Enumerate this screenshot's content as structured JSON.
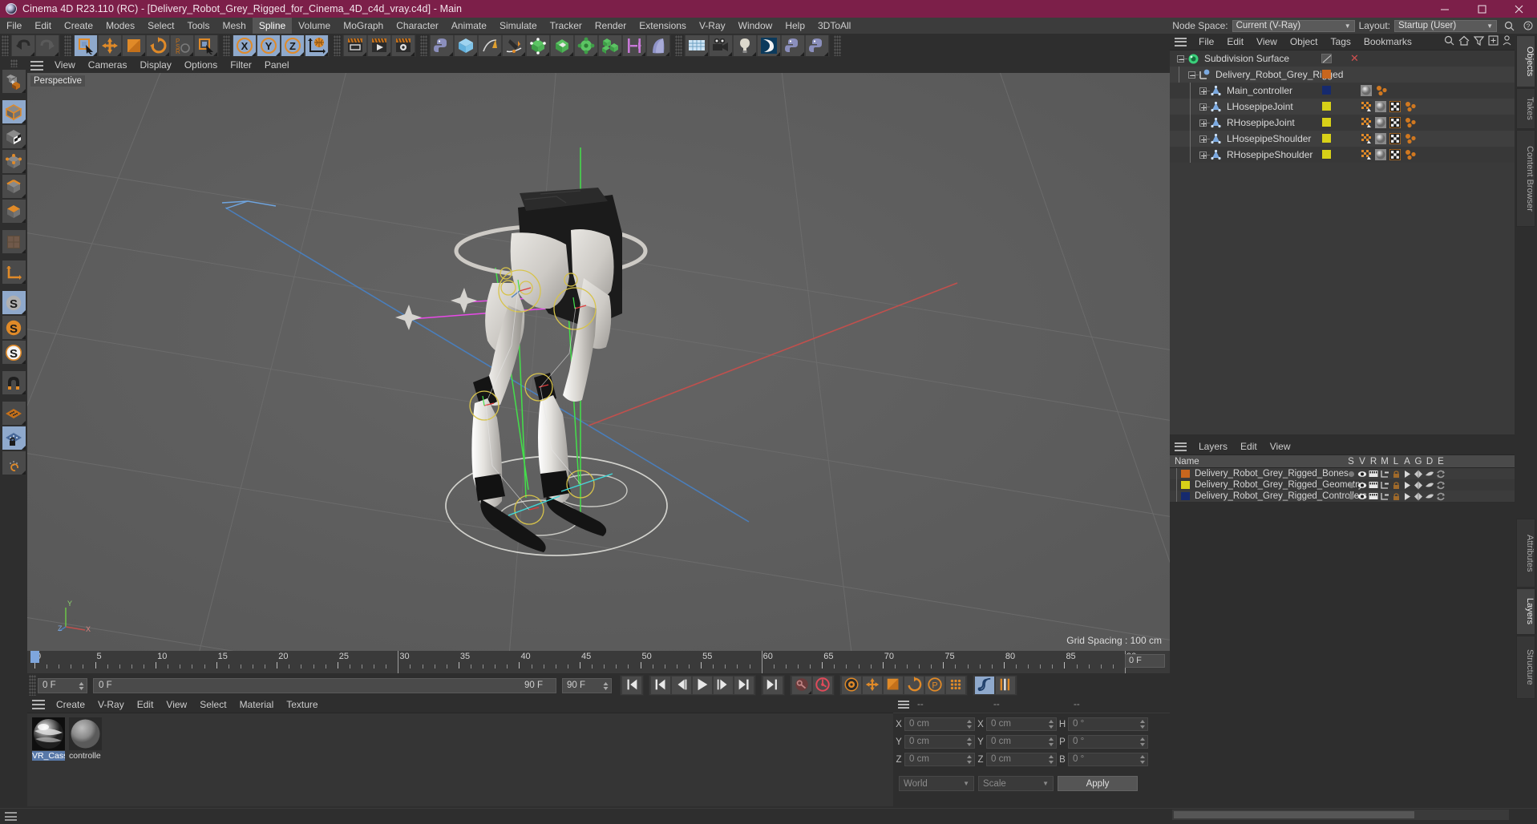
{
  "window": {
    "title": "Cinema 4D R23.110 (RC) - [Delivery_Robot_Grey_Rigged_for_Cinema_4D_c4d_vray.c4d] - Main",
    "minimize": "─",
    "maximize": "□",
    "close": "✕",
    "titlebar_color": "#7c1f49"
  },
  "menubar": {
    "items": [
      {
        "label": "File"
      },
      {
        "label": "Edit"
      },
      {
        "label": "Create"
      },
      {
        "label": "Modes"
      },
      {
        "label": "Select"
      },
      {
        "label": "Tools"
      },
      {
        "label": "Mesh"
      },
      {
        "label": "Spline",
        "active": true
      },
      {
        "label": "Volume"
      },
      {
        "label": "MoGraph"
      },
      {
        "label": "Character"
      },
      {
        "label": "Animate"
      },
      {
        "label": "Simulate"
      },
      {
        "label": "Tracker"
      },
      {
        "label": "Render"
      },
      {
        "label": "Extensions"
      },
      {
        "label": "V-Ray"
      },
      {
        "label": "Window"
      },
      {
        "label": "Help"
      },
      {
        "label": "3DToAll"
      }
    ],
    "node_space_label": "Node Space:",
    "node_space_value": "Current (V-Ray)",
    "layout_label": "Layout:",
    "layout_value": "Startup (User)"
  },
  "toolbar": {
    "groups": [
      {
        "name": "history",
        "buttons": [
          {
            "name": "undo-button",
            "icon": "undo"
          },
          {
            "name": "redo-button",
            "icon": "redo"
          }
        ]
      },
      {
        "name": "transform",
        "buttons": [
          {
            "name": "select-tool-button",
            "icon": "select-cursor",
            "selected": true
          },
          {
            "name": "move-tool-button",
            "icon": "move-arrows"
          },
          {
            "name": "scale-tool-button",
            "icon": "scale-box"
          },
          {
            "name": "rotate-tool-button",
            "icon": "rotate-arrows"
          },
          {
            "name": "psr-lock-button",
            "icon": "psr"
          },
          {
            "name": "live-selection-button",
            "icon": "select-cursor"
          }
        ]
      },
      {
        "name": "axis-locks",
        "buttons": [
          {
            "name": "lock-x-axis-button",
            "icon": "axis-x",
            "selected": true
          },
          {
            "name": "lock-y-axis-button",
            "icon": "axis-y",
            "selected": true
          },
          {
            "name": "lock-z-axis-button",
            "icon": "axis-z",
            "selected": true
          },
          {
            "name": "world-coordinates-button",
            "icon": "globe-axis",
            "selected": true
          }
        ]
      },
      {
        "name": "render",
        "buttons": [
          {
            "name": "render-view-button",
            "icon": "render-view"
          },
          {
            "name": "render-to-picture-viewer-button",
            "icon": "render-picture"
          },
          {
            "name": "render-settings-button",
            "icon": "render-settings"
          }
        ]
      },
      {
        "name": "objects",
        "buttons": [
          {
            "name": "python-generator-button",
            "icon": "python"
          },
          {
            "name": "add-cube-button",
            "icon": "cube-blue"
          },
          {
            "name": "add-spline-button",
            "icon": "spline-pen"
          },
          {
            "name": "spline-pen-button",
            "icon": "pen-curve"
          },
          {
            "name": "add-nurbs-button",
            "icon": "nurbs"
          },
          {
            "name": "add-array-button",
            "icon": "array-green"
          },
          {
            "name": "add-deformer-button",
            "icon": "deformer"
          },
          {
            "name": "add-modeling-object-button",
            "icon": "cubes-green"
          },
          {
            "name": "add-instance-button",
            "icon": "instance"
          },
          {
            "name": "add-bend-button",
            "icon": "bend"
          }
        ]
      },
      {
        "name": "scene",
        "buttons": [
          {
            "name": "add-floor-button",
            "icon": "floor-grid"
          },
          {
            "name": "add-camera-button",
            "icon": "camera"
          },
          {
            "name": "add-light-button",
            "icon": "light-bulb"
          },
          {
            "name": "vray-bridge-button",
            "icon": "vray-logo"
          },
          {
            "name": "python-script-button",
            "icon": "python"
          },
          {
            "name": "python-script-2-button",
            "icon": "python"
          }
        ]
      }
    ]
  },
  "left_toolbar": {
    "buttons": [
      {
        "name": "make-editable-button",
        "icon": "make-editable"
      },
      {
        "name": "model-mode-button",
        "icon": "model-cube",
        "selected": true
      },
      {
        "name": "texture-mode-button",
        "icon": "texture-cube"
      },
      {
        "name": "points-mode-button",
        "icon": "points-cube"
      },
      {
        "name": "edges-mode-button",
        "icon": "edges-cube"
      },
      {
        "name": "polygons-mode-button",
        "icon": "polygons-cube"
      },
      {
        "name": "uv-mode-button",
        "icon": "uv-grid"
      },
      {
        "name": "axis-mode-button",
        "icon": "axis-L"
      },
      {
        "name": "enable-snapping-button",
        "icon": "snap-s",
        "selected": true
      },
      {
        "name": "snap-settings-button",
        "icon": "snap-s-orange"
      },
      {
        "name": "quantize-button",
        "icon": "snap-s-white"
      },
      {
        "name": "magnet-button",
        "icon": "magnet"
      },
      {
        "name": "workplane-button",
        "icon": "workplane"
      },
      {
        "name": "lock-workplane-button",
        "icon": "workplane-lock",
        "selected": true
      },
      {
        "name": "planar-workplane-button",
        "icon": "workplane-rotate"
      }
    ]
  },
  "viewport": {
    "menu": [
      "View",
      "Cameras",
      "Display",
      "Options",
      "Filter",
      "Panel"
    ],
    "label": "Perspective",
    "grid_spacing": "Grid Spacing : 100 cm",
    "axis_labels": {
      "x": "X",
      "y": "Y",
      "z": "Z"
    },
    "background_color": "#5e5e5e",
    "axis_x_color": "#c0504d",
    "axis_z_color": "#4a7ebb",
    "axis_y_color": "#6bbf4a"
  },
  "object_manager": {
    "menu": [
      "File",
      "Edit",
      "View",
      "Object",
      "Tags",
      "Bookmarks"
    ],
    "icons": [
      "search-icon",
      "home-icon",
      "filter-icon",
      "plus-box-icon",
      "person-icon"
    ],
    "rows": [
      {
        "name": "Subdivision Surface",
        "depth": 0,
        "icon": "subdivision-surface",
        "swatch": null,
        "expander": "minus",
        "has_close": true,
        "tags": []
      },
      {
        "name": "Delivery_Robot_Grey_Rigged",
        "depth": 1,
        "icon": "null-object",
        "swatch": "#c8661e",
        "expander": "minus",
        "has_close": false,
        "tags": []
      },
      {
        "name": "Main_controller",
        "depth": 2,
        "icon": "joint",
        "swatch": "#162a6e",
        "expander": "plus",
        "has_close": false,
        "tags": [
          "sphere-tag",
          "dots-tag"
        ]
      },
      {
        "name": "LHosepipeJoint",
        "depth": 2,
        "icon": "joint",
        "swatch": "#d8d118",
        "expander": "plus",
        "has_close": false,
        "tags": [
          "weight-tag",
          "sphere-tag",
          "checker-tag",
          "dots-tag"
        ]
      },
      {
        "name": "RHosepipeJoint",
        "depth": 2,
        "icon": "joint",
        "swatch": "#d8d118",
        "expander": "plus",
        "has_close": false,
        "tags": [
          "weight-tag",
          "sphere-tag",
          "checker-tag",
          "dots-tag"
        ]
      },
      {
        "name": "LHosepipeShoulder",
        "depth": 2,
        "icon": "joint",
        "swatch": "#d8d118",
        "expander": "plus",
        "has_close": false,
        "tags": [
          "weight-tag",
          "sphere-tag",
          "checker-tag",
          "dots-tag"
        ]
      },
      {
        "name": "RHosepipeShoulder",
        "depth": 2,
        "icon": "joint",
        "swatch": "#d8d118",
        "expander": "plus",
        "has_close": false,
        "tags": [
          "weight-tag",
          "sphere-tag",
          "checker-tag",
          "dots-tag"
        ]
      }
    ]
  },
  "layers_manager": {
    "menu": [
      "Layers",
      "Edit",
      "View"
    ],
    "columns": [
      "Name",
      "S",
      "V",
      "R",
      "M",
      "L",
      "A",
      "G",
      "D",
      "E"
    ],
    "rows": [
      {
        "name": "Delivery_Robot_Grey_Rigged_Bones",
        "color": "#c8661e"
      },
      {
        "name": "Delivery_Robot_Grey_Rigged_Geometry",
        "color": "#d8d118"
      },
      {
        "name": "Delivery_Robot_Grey_Rigged_Controllers",
        "color": "#162a6e"
      }
    ]
  },
  "right_tabs": {
    "top": [
      {
        "label": "Objects",
        "active": true
      },
      {
        "label": "Takes",
        "active": false
      },
      {
        "label": "Content Browser",
        "active": false
      }
    ],
    "bottom": [
      {
        "label": "Attributes",
        "active": false
      },
      {
        "label": "Layers",
        "active": true
      },
      {
        "label": "Structure",
        "active": false
      }
    ]
  },
  "timeline": {
    "ticks": [
      0,
      5,
      10,
      15,
      20,
      25,
      30,
      35,
      40,
      45,
      50,
      55,
      60,
      65,
      70,
      75,
      80,
      85,
      90
    ],
    "min_frame": 0,
    "max_frame": 90,
    "current_frame": 0,
    "current_frame_field": "0 F",
    "current_frame_spinner": "0 F",
    "range_start": "0 F",
    "range_end": "90 F",
    "preview_end": "90 F",
    "transport": [
      {
        "name": "go-to-start-button",
        "icon": "skip-start"
      },
      {
        "name": "previous-key-button",
        "icon": "prev-key"
      },
      {
        "name": "previous-frame-button",
        "icon": "prev-frame"
      },
      {
        "name": "play-button",
        "icon": "play"
      },
      {
        "name": "next-frame-button",
        "icon": "next-frame"
      },
      {
        "name": "next-key-button",
        "icon": "next-key"
      },
      {
        "name": "go-to-end-button",
        "icon": "skip-end"
      },
      {
        "name": "record-active-objects-button",
        "icon": "key-record"
      },
      {
        "name": "autokeying-button",
        "icon": "auto-key"
      },
      {
        "name": "keyframe-selection-button",
        "icon": "keyframe-gear"
      },
      {
        "name": "position-key-button",
        "icon": "position-cross"
      },
      {
        "name": "scale-key-button",
        "icon": "scale-key"
      },
      {
        "name": "rotation-key-button",
        "icon": "rotation-key"
      },
      {
        "name": "param-key-button",
        "icon": "param-p"
      },
      {
        "name": "point-level-animation-button",
        "icon": "pla-dots"
      },
      {
        "name": "animation-mode-button",
        "icon": "anim-mode",
        "selected": true
      },
      {
        "name": "timeline-toggle-button",
        "icon": "timeline-bars"
      }
    ]
  },
  "material_manager": {
    "menu": [
      "Create",
      "V-Ray",
      "Edit",
      "View",
      "Select",
      "Material",
      "Texture"
    ],
    "materials": [
      {
        "name": "VR_Cassi",
        "thumb": "chrome",
        "selected": true
      },
      {
        "name": "controlle",
        "thumb": "grey",
        "selected": false
      }
    ]
  },
  "coordinates": {
    "header": [
      "--",
      "--",
      "--"
    ],
    "rows": [
      {
        "axis": "X",
        "position": "0 cm",
        "axis2": "X",
        "size": "0 cm",
        "rot_label": "H",
        "rotation": "0 °"
      },
      {
        "axis": "Y",
        "position": "0 cm",
        "axis2": "Y",
        "size": "0 cm",
        "rot_label": "P",
        "rotation": "0 °"
      },
      {
        "axis": "Z",
        "position": "0 cm",
        "axis2": "Z",
        "size": "0 cm",
        "rot_label": "B",
        "rotation": "0 °"
      }
    ],
    "coord_system": "World",
    "size_mode": "Scale",
    "apply_label": "Apply"
  }
}
